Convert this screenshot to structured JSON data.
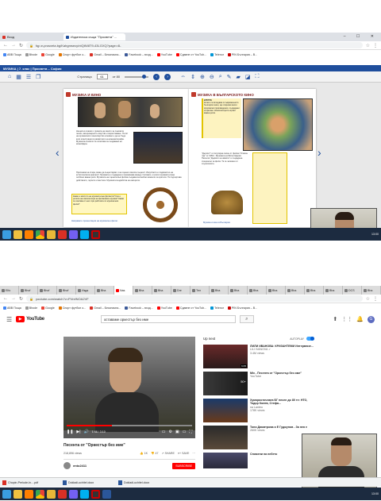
{
  "top": {
    "tabs": [
      {
        "label": "Вход"
      },
      {
        "label": "Издателска къща \"Просвета\" ..."
      }
    ],
    "address": "fqp.e-prosveta.bg/Kahgmsecy/ntQtN/8T9-43LGXQ?page=4L",
    "bookmarks": [
      "ABB Поща",
      "Bhode",
      "Google",
      "Спорт футбол о...",
      "Gmail – Безопасна...",
      "Facebook – вход...",
      "YouTube",
      "Сдавне от YouTub...",
      "Telenor",
      "DVE Вход...",
      "PIN България – В..."
    ],
    "viewer": {
      "title": "МУЗИКА | 7. клас | Просвета – София",
      "page_label": "Страница",
      "page_value": "61",
      "page_of": "от 80"
    },
    "left_page": {
      "heading": "МУЗИКА И КИНО",
      "para1": "Нещата в сказки и грижата на киното за лъвовите песни, ватеринарното изкуство и мореплаване. Пътят на музикалното киноизкуство основно е да не бъде като илюстрация в развитието на кинематографа. Музиката в киното се използва за създаване на атмосфера.",
      "para2": "Приложим на стара, може да съществуват и на сцена в своята същност. Изкуството е подвластно на естетическата реалност. Музиката е създадена и преминава между стиловете, в които музиката играе особено важна роля.",
      "para3": "Музиката на сцената във филма създава вълшебни моменти за зрителя. Тя подчертава действието, героите и местата. Музиката въздейства на емоциите.",
      "note": "Какво е мястото на музиката във филмите? Коя е ролята на композитора на филмовата музика? Какво се изисква от него при работата по музикалния филм?",
      "footer": "Направете презентация на музикален филм."
    },
    "right_page": {
      "heading": "МУЗИКА В БЪЛГАРСКОТО КИНО",
      "label_box": "КЛУТРА",
      "text1": "Когато се вгледаме в съвременното българско кино, ще открием много музикални произведения, създадени за филми. Композиторите играят важна роля.",
      "text2": "\"Дързост\" е популярна песен от филма \"Опасен чар\" от 1984 г. Музиката на Митко Щерев.",
      "text3": "Песента \"Дървото на живота\" е създадена специално за филм. Тя се запомня от слушателите.",
      "footer": "Музика и кино в България"
    },
    "taskbar_time": "13:00"
  },
  "bottom": {
    "tabs": [
      "Elfo",
      "Bhof",
      "Bhof",
      "Bhof",
      "Изда",
      "Bha",
      "Nas",
      "Bha",
      "Bha",
      "Dre",
      "Тел",
      "Bha",
      "Bha",
      "Bha",
      "Bha",
      "Bha",
      "Bha",
      "Bha",
      "DCS",
      "Bha"
    ],
    "address": "youtube.com/watch?v=PVrxfNOA2VF",
    "bookmarks": [
      "ABB Поща",
      "Bhode",
      "Google",
      "Спорт футбол о...",
      "Gmail – Безопасна...",
      "Facebook – вход...",
      "YouTube",
      "Сдавне от YouTub...",
      "Telenor",
      "DVE Вход...",
      "PIN България – В..."
    ],
    "yt": {
      "logo": "YouTube",
      "search_value": "оставаме оркестър без име",
      "video_title": "Песента от \"Оркестър без име\"",
      "views": "218,896 views",
      "likes": "1K",
      "dislikes": "47",
      "share": "SHARE",
      "save": "SAVE",
      "time": "1:48 / 3:10",
      "channel": "ento2411",
      "subscribe": "SUBSCRIBE",
      "up_next": "Up next",
      "autoplay": "AUTOPLAY",
      "list": [
        {
          "title": "ЛИЛИ ИВАНОВА: КРИЗАНТЕМИ Интервюзе...",
          "channel": "LILI IVANOVA ✓",
          "views": "3.4M views",
          "dur": "6:05"
        },
        {
          "title": "Mix - Песента от \"Оркестър без име\"",
          "channel": "YouTube",
          "views": "",
          "dur": "50+"
        },
        {
          "title": "Хумористичната БГ песен до 80 те: НТО, Тодор Колев, Стефа...",
          "channel": "na Lanteu",
          "views": "178K views",
          "dur": ""
        },
        {
          "title": "Тони Димитрова и Е Гуджунов - За нея е",
          "channel": "",
          "views": "260K views",
          "dur": ""
        },
        {
          "title": "Спомени на небето",
          "channel": "",
          "views": "",
          "dur": ""
        }
      ]
    },
    "downloads": [
      "Chopin-Prelude-In....pdf",
      "Dokladi-uchitel.docx",
      "Dokladi-uchitel.docx"
    ],
    "taskbar_time": "13:00"
  },
  "colors": {
    "viewer_bar": "#1f4e9c",
    "yt_red": "#ff0000",
    "taskbar": "#1c2b40"
  }
}
